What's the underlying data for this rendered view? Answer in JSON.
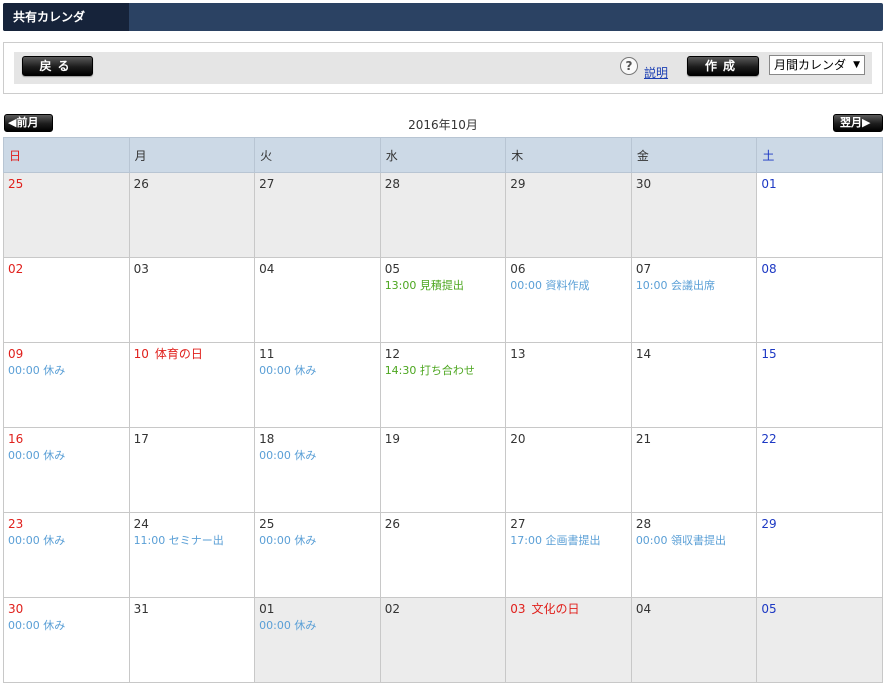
{
  "app": {
    "title": "共有カレンダ"
  },
  "toolbar": {
    "back_label": "戻る",
    "help_icon": "?",
    "help_label": "説明",
    "create_label": "作成",
    "view_select": "月間カレンダ"
  },
  "nav": {
    "prev_label": "前月",
    "next_label": "翌月",
    "month_title": "2016年10月"
  },
  "weekdays": [
    "日",
    "月",
    "火",
    "水",
    "木",
    "金",
    "土"
  ],
  "colors": {
    "sunday": "#e0201c",
    "saturday": "#1d39c4",
    "event": "#5a9fd6",
    "event_green": "#4ca61f",
    "header_bg": "#ccd9e6",
    "titlebar": "#2b4263"
  },
  "weeks": [
    [
      {
        "day": "25",
        "other": true
      },
      {
        "day": "26",
        "other": true
      },
      {
        "day": "27",
        "other": true
      },
      {
        "day": "28",
        "other": true
      },
      {
        "day": "29",
        "other": true
      },
      {
        "day": "30",
        "other": true
      },
      {
        "day": "01"
      }
    ],
    [
      {
        "day": "02"
      },
      {
        "day": "03"
      },
      {
        "day": "04"
      },
      {
        "day": "05",
        "events": [
          {
            "text": "13:00 見積提出",
            "green": true
          }
        ]
      },
      {
        "day": "06",
        "events": [
          {
            "text": "00:00 資料作成"
          }
        ]
      },
      {
        "day": "07",
        "events": [
          {
            "text": "10:00 会議出席"
          }
        ]
      },
      {
        "day": "08"
      }
    ],
    [
      {
        "day": "09",
        "events": [
          {
            "text": "00:00 休み"
          }
        ]
      },
      {
        "day": "10",
        "holiday": "体育の日",
        "red": true
      },
      {
        "day": "11",
        "events": [
          {
            "text": "00:00 休み"
          }
        ]
      },
      {
        "day": "12",
        "events": [
          {
            "text": "14:30 打ち合わせ",
            "green": true
          }
        ]
      },
      {
        "day": "13"
      },
      {
        "day": "14"
      },
      {
        "day": "15"
      }
    ],
    [
      {
        "day": "16",
        "events": [
          {
            "text": "00:00 休み"
          }
        ]
      },
      {
        "day": "17"
      },
      {
        "day": "18",
        "events": [
          {
            "text": "00:00 休み"
          }
        ]
      },
      {
        "day": "19"
      },
      {
        "day": "20"
      },
      {
        "day": "21"
      },
      {
        "day": "22"
      }
    ],
    [
      {
        "day": "23",
        "events": [
          {
            "text": "00:00 休み"
          }
        ]
      },
      {
        "day": "24",
        "events": [
          {
            "text": "11:00 セミナー出"
          }
        ]
      },
      {
        "day": "25",
        "events": [
          {
            "text": "00:00 休み"
          }
        ]
      },
      {
        "day": "26"
      },
      {
        "day": "27",
        "events": [
          {
            "text": "17:00 企画書提出"
          }
        ]
      },
      {
        "day": "28",
        "events": [
          {
            "text": "00:00 領収書提出"
          }
        ]
      },
      {
        "day": "29"
      }
    ],
    [
      {
        "day": "30",
        "events": [
          {
            "text": "00:00 休み"
          }
        ]
      },
      {
        "day": "31"
      },
      {
        "day": "01",
        "other": true,
        "events": [
          {
            "text": "00:00 休み"
          }
        ]
      },
      {
        "day": "02",
        "other": true
      },
      {
        "day": "03",
        "other": true,
        "holiday": "文化の日",
        "red": true
      },
      {
        "day": "04",
        "other": true
      },
      {
        "day": "05",
        "other": true
      }
    ]
  ]
}
